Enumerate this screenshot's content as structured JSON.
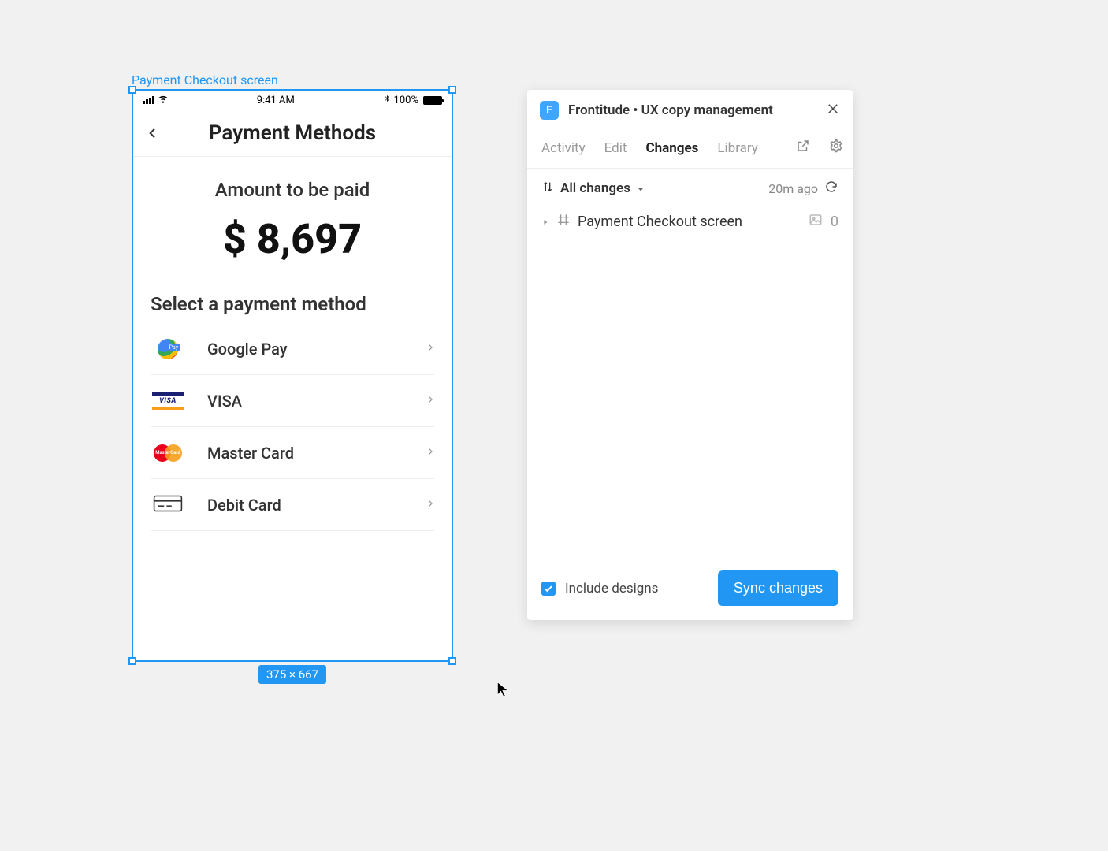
{
  "canvas": {
    "frame_label": "Payment Checkout screen",
    "dimensions_badge": "375 × 667"
  },
  "mockup": {
    "status_bar": {
      "time": "9:41 AM",
      "battery_pct": "100%"
    },
    "header": {
      "title": "Payment Methods"
    },
    "amount": {
      "label": "Amount to be paid",
      "value": "$ 8,697"
    },
    "select_label": "Select a payment method",
    "payment_methods": [
      {
        "icon": "google-pay-icon",
        "name": "Google Pay"
      },
      {
        "icon": "visa-icon",
        "name": "VISA"
      },
      {
        "icon": "mastercard-icon",
        "name": "Master Card"
      },
      {
        "icon": "debit-card-icon",
        "name": "Debit Card"
      }
    ]
  },
  "panel": {
    "brand_initial": "F",
    "title": "Frontitude • UX copy management",
    "tabs": {
      "activity": "Activity",
      "edit": "Edit",
      "changes": "Changes",
      "library": "Library"
    },
    "filter_label": "All changes",
    "time_ago": "20m ago",
    "change_item": {
      "name": "Payment Checkout screen",
      "count": "0"
    },
    "footer": {
      "include_designs_label": "Include designs",
      "include_designs_checked": true,
      "sync_button_label": "Sync changes"
    }
  }
}
